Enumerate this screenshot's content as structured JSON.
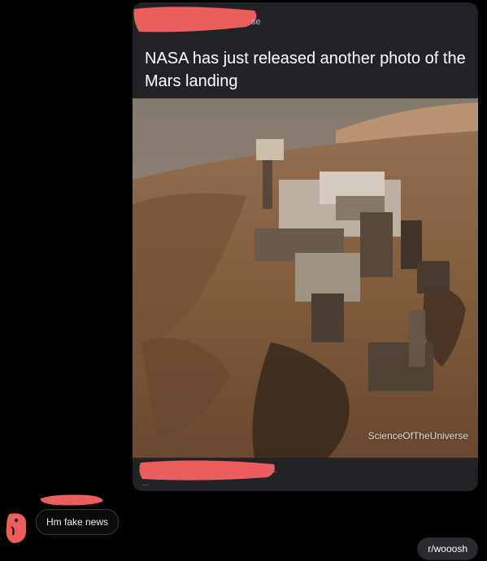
{
  "post": {
    "handle_tail": "se",
    "title": "NASA has just released another photo of the Mars landing",
    "watermark": "ScienceOfTheUniverse",
    "ellipsis": "...",
    "more": "..."
  },
  "comment": {
    "text": "Hm fake news"
  },
  "reply": {
    "text": "r/wooosh"
  },
  "colors": {
    "redaction": "#ec5d5d",
    "card": "#222327",
    "background": "#000000"
  }
}
